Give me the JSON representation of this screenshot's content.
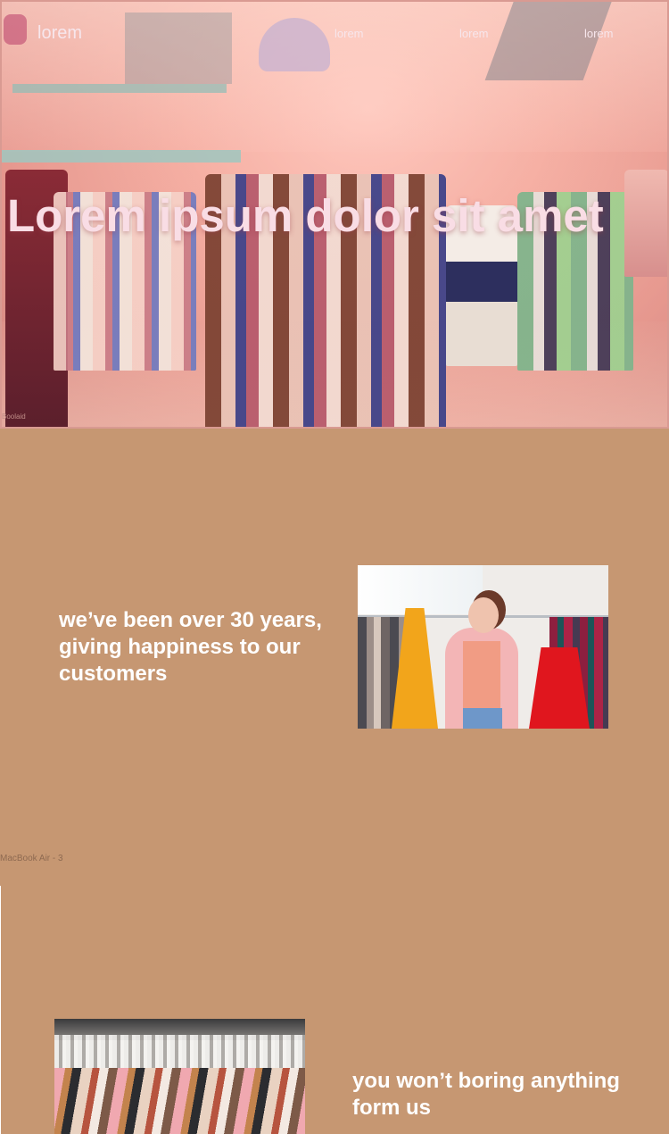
{
  "header": {
    "logo": "lorem",
    "nav": [
      "lorem",
      "lorem",
      "lorem"
    ]
  },
  "hero": {
    "title": "Lorem ipsum dolor sit amet",
    "caption": "Boolaid"
  },
  "section1": {
    "text": "we’ve been over 30 years, giving happiness to our customers"
  },
  "frame_label": "MacBook Air - 3",
  "section2": {
    "text": "you won’t boring anything form us"
  },
  "colors": {
    "page_background": "#c69772",
    "hero_tint": "#f1b3a6",
    "text": "#ffffff"
  }
}
